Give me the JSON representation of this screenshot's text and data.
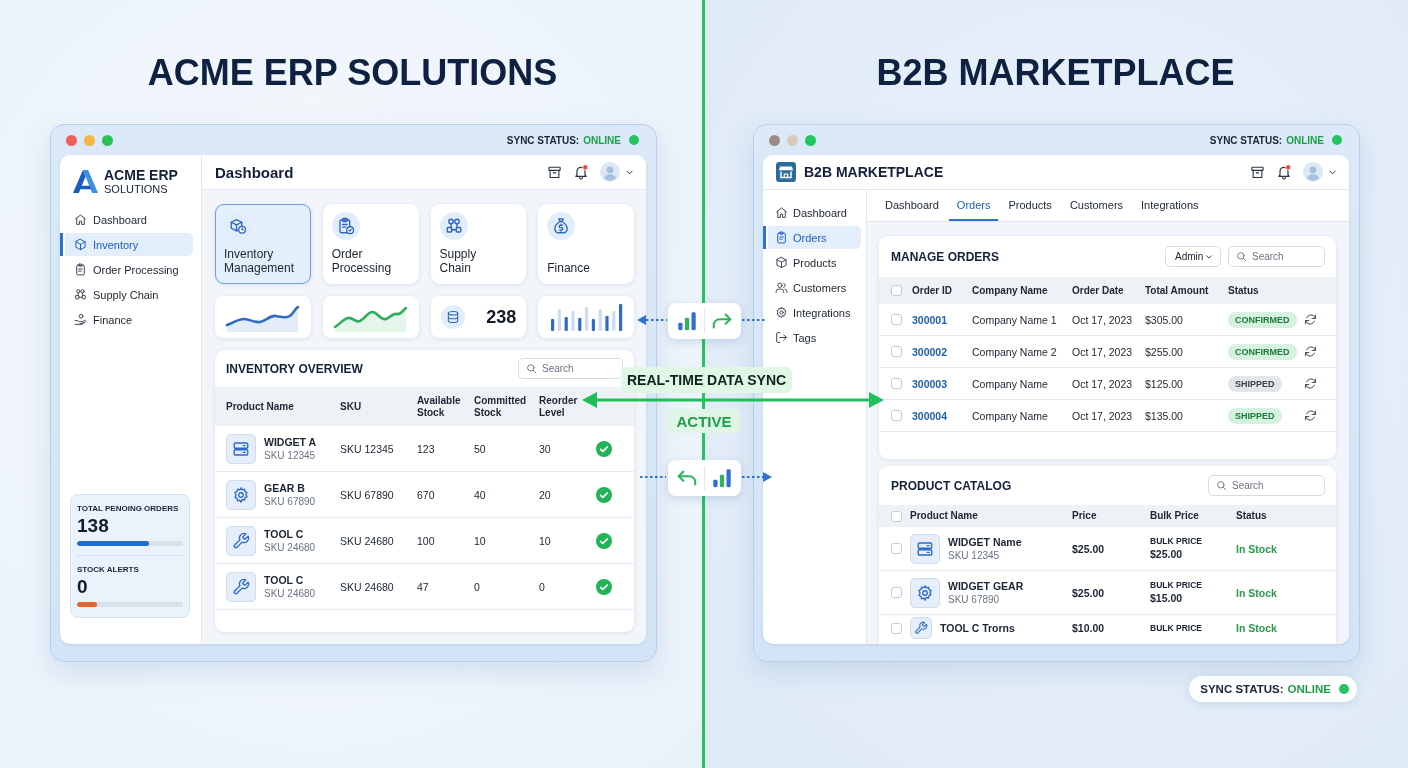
{
  "erp": {
    "heading": "ACME ERP SOLUTIONS",
    "window_controls": [
      {
        "color": "#ef5f57"
      },
      {
        "color": "#f4b63f"
      },
      {
        "color": "#2cc152"
      }
    ],
    "sync_status": {
      "label": "SYNC STATUS:",
      "value": "ONLINE",
      "online": true
    },
    "brand": {
      "name": "ACME ERP",
      "subtitle": "SOLUTIONS"
    },
    "page_title": "Dashboard",
    "notifications": true,
    "sidebar": {
      "items": [
        {
          "label": "Dashboard",
          "selected": false
        },
        {
          "label": "Inventory",
          "selected": true
        },
        {
          "label": "Order Processing",
          "selected": false
        },
        {
          "label": "Supply Chain",
          "selected": false
        },
        {
          "label": "Finance",
          "selected": false
        }
      ]
    },
    "summary": [
      {
        "label": "TOTAL PENOING ORDERS",
        "value": "138",
        "level": 0.68,
        "color": "#1f6fd1"
      },
      {
        "label": "STOCK ALERTS",
        "value": "0",
        "level": 0.19,
        "color": "#e4622d"
      }
    ],
    "modules": [
      {
        "label": "Inventory Management",
        "selected": true
      },
      {
        "label": "Order Processing",
        "selected": false
      },
      {
        "label": "Supply Chain",
        "selected": false
      },
      {
        "label": "Finance",
        "selected": false
      }
    ],
    "widgets": [
      {
        "kind": "line",
        "color": "#2f6cc2"
      },
      {
        "kind": "line",
        "color": "#2fae5a"
      },
      {
        "kind": "kpi",
        "value": "238"
      },
      {
        "kind": "bars"
      }
    ],
    "inventory": {
      "title": "INVENTORY OVERVIEW",
      "search": {
        "placeholder": "Search"
      },
      "columns": [
        "Product Name",
        "SKU",
        "Available Stock",
        "Committed Stock",
        "Reorder Level"
      ],
      "rows": [
        {
          "name": "WIDGET A",
          "code": "SKU 12345",
          "sku": "SKU 12345",
          "available": "123",
          "committed": "50",
          "reorder": "30",
          "ok": true
        },
        {
          "name": "GEAR B",
          "code": "SKU 67890",
          "sku": "SKU 67890",
          "available": "670",
          "committed": "40",
          "reorder": "20",
          "ok": true
        },
        {
          "name": "TOOL C",
          "code": "SKU 24680",
          "sku": "SKU 24680",
          "available": "100",
          "committed": "10",
          "reorder": "10",
          "ok": true
        },
        {
          "name": "TOOL C",
          "code": "SKU 24680",
          "sku": "SKU 24680",
          "available": "47",
          "committed": "0",
          "reorder": "0",
          "ok": true
        }
      ]
    }
  },
  "sync": {
    "label": "REAL-TIME DATA SYNC",
    "status": "ACTIVE"
  },
  "b2b": {
    "heading": "B2B MARKETPLACE",
    "window_controls": [
      {
        "color": "#9c8a86"
      },
      {
        "color": "#d9c9bc"
      },
      {
        "color": "#22c55e"
      }
    ],
    "sync_status": {
      "label": "SYNC STATUS:",
      "value": "ONLINE",
      "online": true
    },
    "brand": {
      "name": "B2B MARKETPLACE"
    },
    "notifications": true,
    "sidebar": {
      "items": [
        {
          "label": "Dashboard",
          "selected": false
        },
        {
          "label": "Orders",
          "selected": true
        },
        {
          "label": "Products",
          "selected": false
        },
        {
          "label": "Customers",
          "selected": false
        },
        {
          "label": "Integrations",
          "selected": false
        },
        {
          "label": "Tags",
          "selected": false
        }
      ]
    },
    "tabs": [
      {
        "label": "Dashboard",
        "selected": false
      },
      {
        "label": "Orders",
        "selected": true
      },
      {
        "label": "Products",
        "selected": false
      },
      {
        "label": "Customers",
        "selected": false
      },
      {
        "label": "Integrations",
        "selected": false
      }
    ],
    "orders": {
      "title": "MANAGE ORDERS",
      "role": "Admin",
      "search": {
        "placeholder": "Search"
      },
      "all_checked": false,
      "columns": [
        "Order ID",
        "Company Name",
        "Order Date",
        "Total Amount",
        "Status"
      ],
      "rows": [
        {
          "id": "300001",
          "company": "Company Name 1",
          "date": "Oct 17, 2023",
          "amount": "$305.00",
          "status": "CONFIRMED",
          "color": "#d4f2dd",
          "checked": false
        },
        {
          "id": "300002",
          "company": "Company Name 2",
          "date": "Oct 17, 2023",
          "amount": "$255.00",
          "status": "CONFIRMED",
          "color": "#d4f2dd",
          "checked": false
        },
        {
          "id": "300003",
          "company": "Company Name",
          "date": "Oct 17, 2023",
          "amount": "$125.00",
          "status": "SHIPPED",
          "color": "#e3e5e9",
          "checked": false
        },
        {
          "id": "300004",
          "company": "Company Name",
          "date": "Oct 17, 2023",
          "amount": "$135.00",
          "status": "SHIPPED",
          "color": "#d4f2dd",
          "checked": false
        }
      ]
    },
    "catalog": {
      "title": "PRODUCT CATALOG",
      "search": {
        "placeholder": "Search"
      },
      "all_checked": false,
      "columns": [
        "Product Name",
        "Price",
        "Bulk Price",
        "Status"
      ],
      "rows": [
        {
          "name": "WIDGET Name",
          "sku": "SKU 12345",
          "price": "$25.00",
          "bulk_label": "BULK PRICE",
          "bulk_price": "$25.00",
          "status": "In Stock",
          "checked": false
        },
        {
          "name": "WIDGET GEAR",
          "sku": "SKU 67890",
          "price": "$25.00",
          "bulk_label": "BULK PRICE",
          "bulk_price": "$15.00",
          "status": "In Stock",
          "checked": false
        },
        {
          "name": "TOOL C Trorns",
          "price": "$10.00",
          "bulk_label": "BULK PRICE",
          "status": "In Stock",
          "checked": false
        }
      ]
    },
    "footer_status": {
      "label": "SYNC STATUS:",
      "value": "ONLINE",
      "online": true
    }
  }
}
